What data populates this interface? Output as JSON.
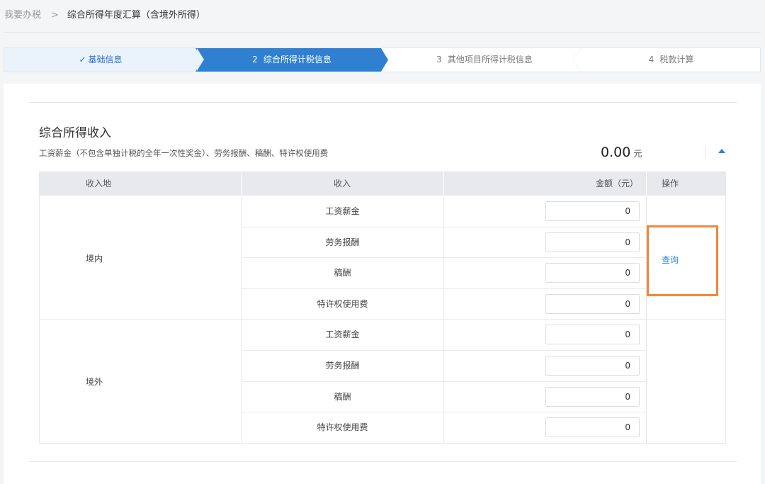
{
  "breadcrumb": {
    "root": "我要办税",
    "separator": ">",
    "current": "综合所得年度汇算（含境外所得）"
  },
  "steps": [
    {
      "num": "",
      "label": "基础信息",
      "state": "done"
    },
    {
      "num": "2",
      "label": "综合所得计税信息",
      "state": "active"
    },
    {
      "num": "3",
      "label": "其他项目所得计税信息",
      "state": "pending"
    },
    {
      "num": "4",
      "label": "税款计算",
      "state": "pending"
    }
  ],
  "section": {
    "title": "综合所得收入",
    "description": "工资薪金（不包含单独计税的全年一次性奖金）、劳务报酬、稿酬、特许权使用费",
    "total_amount": "0.00",
    "total_unit": "元"
  },
  "table": {
    "headers": {
      "source": "收入地",
      "income": "收入",
      "amount": "金额（元）",
      "operation": "操作"
    },
    "regions": [
      {
        "name": "境内",
        "items": [
          {
            "label": "工资薪金",
            "amount": "0"
          },
          {
            "label": "劳务报酬",
            "amount": "0"
          },
          {
            "label": "稿酬",
            "amount": "0"
          },
          {
            "label": "特许权使用费",
            "amount": "0"
          }
        ],
        "action": "查询"
      },
      {
        "name": "境外",
        "items": [
          {
            "label": "工资薪金",
            "amount": "0"
          },
          {
            "label": "劳务报酬",
            "amount": "0"
          },
          {
            "label": "稿酬",
            "amount": "0"
          },
          {
            "label": "特许权使用费",
            "amount": "0"
          }
        ]
      }
    ]
  },
  "colors": {
    "accent": "#2f80d1",
    "done_bg": "#eaf3fc",
    "highlight": "#f0883c"
  }
}
